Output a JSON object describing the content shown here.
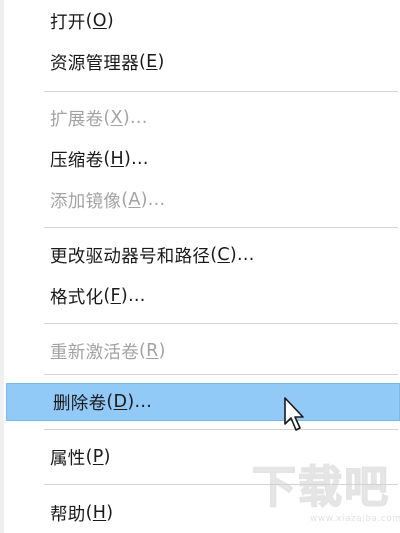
{
  "menu": {
    "items": [
      {
        "label": "打开",
        "accel": "O",
        "suffix": ""
      },
      {
        "label": "资源管理器",
        "accel": "E",
        "suffix": ""
      },
      {
        "label": "扩展卷",
        "accel": "X",
        "suffix": "..."
      },
      {
        "label": "压缩卷",
        "accel": "H",
        "suffix": "..."
      },
      {
        "label": "添加镜像",
        "accel": "A",
        "suffix": "..."
      },
      {
        "label": "更改驱动器号和路径",
        "accel": "C",
        "suffix": "..."
      },
      {
        "label": "格式化",
        "accel": "F",
        "suffix": "..."
      },
      {
        "label": "重新激活卷",
        "accel": "R",
        "suffix": ""
      },
      {
        "label": "删除卷",
        "accel": "D",
        "suffix": "..."
      },
      {
        "label": "属性",
        "accel": "P",
        "suffix": ""
      },
      {
        "label": "帮助",
        "accel": "H",
        "suffix": ""
      }
    ]
  },
  "watermark": {
    "text": "下载吧",
    "url": "www.xiazaiba.com"
  },
  "colors": {
    "highlight": "#91c9f7",
    "disabled_text": "#a3a3a3",
    "separator": "#d4d4d4"
  }
}
